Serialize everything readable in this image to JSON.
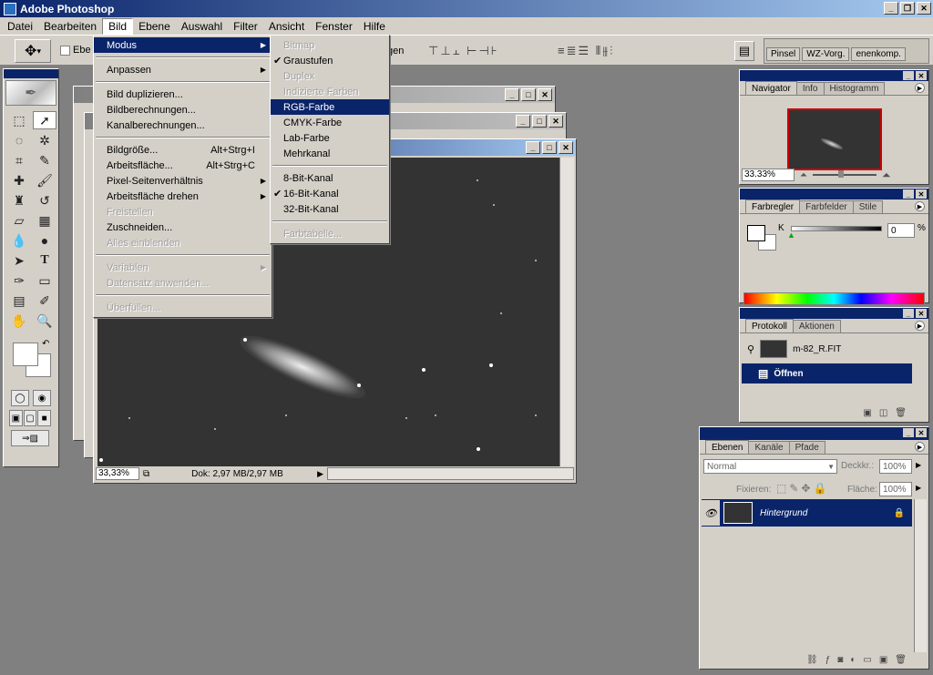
{
  "window": {
    "title": "Adobe Photoshop"
  },
  "menubar": [
    "Datei",
    "Bearbeiten",
    "Bild",
    "Ebene",
    "Auswahl",
    "Filter",
    "Ansicht",
    "Fenster",
    "Hilfe"
  ],
  "options_bar": {
    "auto_select_label": "Ebe",
    "trailing_label": "gen"
  },
  "palette_well_tabs": [
    "Pinsel",
    "WZ-Vorg.",
    "enenkomp."
  ],
  "bild_menu": {
    "modus": "Modus",
    "anpassen": "Anpassen",
    "duplizieren": "Bild duplizieren...",
    "bildberechnungen": "Bildberechnungen...",
    "kanalberechnungen": "Kanalberechnungen...",
    "bildgroesse": "Bildgröße...",
    "bildgroesse_shortcut": "Alt+Strg+I",
    "arbeitsflaeche": "Arbeitsfläche...",
    "arbeitsflaeche_shortcut": "Alt+Strg+C",
    "pixelseiten": "Pixel-Seitenverhältnis",
    "drehen": "Arbeitsfläche drehen",
    "freistellen": "Freistellen",
    "zuschneiden": "Zuschneiden...",
    "einblenden": "Alles einblenden",
    "variablen": "Variablen",
    "datensatz": "Datensatz anwenden...",
    "ueberfuellen": "Überfüllen..."
  },
  "modus_menu": {
    "bitmap": "Bitmap",
    "graustufen": "Graustufen",
    "duplex": "Duplex",
    "indiziert": "Indizierte Farben",
    "rgb": "RGB-Farbe",
    "cmyk": "CMYK-Farbe",
    "lab": "Lab-Farbe",
    "mehrkanal": "Mehrkanal",
    "bit8": "8-Bit-Kanal",
    "bit16": "16-Bit-Kanal",
    "bit32": "32-Bit-Kanal",
    "farbtabelle": "Farbtabelle..."
  },
  "document": {
    "zoom": "33,33%",
    "info": "Dok: 2,97 MB/2,97 MB"
  },
  "navigator": {
    "tabs": [
      "Navigator",
      "Info",
      "Histogramm"
    ],
    "zoom": "33.33%"
  },
  "color": {
    "tabs": [
      "Farbregler",
      "Farbfelder",
      "Stile"
    ],
    "channel": "K",
    "value": "0",
    "unit": "%"
  },
  "history": {
    "tabs": [
      "Protokoll",
      "Aktionen"
    ],
    "snapshot": "m-82_R.FIT",
    "step": "Öffnen"
  },
  "layers": {
    "tabs": [
      "Ebenen",
      "Kanäle",
      "Pfade"
    ],
    "blend_mode": "Normal",
    "opacity_label": "Deckkr.:",
    "opacity": "100%",
    "lock_label": "Fixieren:",
    "fill_label": "Fläche:",
    "fill": "100%",
    "layer_name": "Hintergrund"
  },
  "icons": [
    "move-tool-icon",
    "marquee-tool-icon",
    "lasso-tool-icon",
    "magic-wand-icon",
    "crop-icon",
    "slice-icon",
    "healing-brush-icon",
    "brush-icon",
    "stamp-icon",
    "history-brush-icon",
    "eraser-icon",
    "gradient-icon",
    "blur-icon",
    "dodge-icon",
    "path-select-icon",
    "type-icon",
    "pen-icon",
    "shape-icon",
    "notes-icon",
    "eyedropper-icon",
    "hand-icon",
    "zoom-icon",
    "eye-icon",
    "lock-icon",
    "trash-icon"
  ]
}
